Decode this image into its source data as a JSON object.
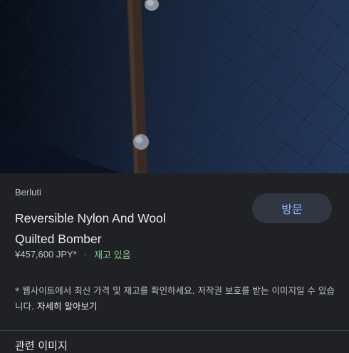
{
  "product": {
    "brand": "Berluti",
    "title_line1": "Reversible Nylon And Wool",
    "title_line2": "Quilted Bomber",
    "price": "¥457,600 JPY*",
    "separator": "·",
    "stock": "재고 있음",
    "visit_label": "방문"
  },
  "disclaimer": {
    "text": "* 웹사이트에서 최신 가격 및 재고를 확인하세요. 저작권 보호를 받는 이미지일 수 있습니다.",
    "link": "자세히 알아보기"
  },
  "related": {
    "title": "관련 이미지"
  },
  "colors": {
    "background": "#202124",
    "accent": "#8ab4f8",
    "stock": "#81c995"
  }
}
